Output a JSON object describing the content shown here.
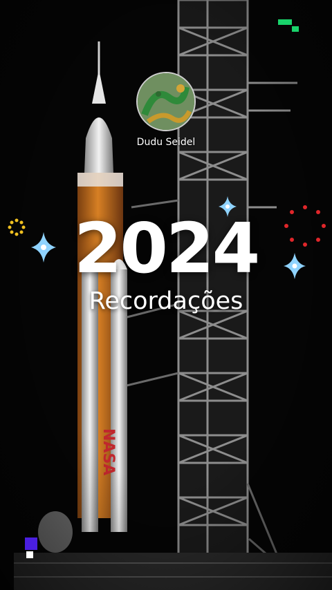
{
  "profile": {
    "name": "Dudu Seidel",
    "avatar_icon": "dragon-avatar-icon"
  },
  "story": {
    "year": "2024",
    "subtitle": "Recordações"
  },
  "colors": {
    "background": "#050505",
    "text": "#ffffff",
    "rocket_orange": "#c9731f",
    "sparkle_blue": "#8fd3ff",
    "firework_red": "#e0262a",
    "gear_yellow": "#f0c020",
    "pixel_green": "#19d36b",
    "pixel_purple": "#4a1fe0"
  }
}
